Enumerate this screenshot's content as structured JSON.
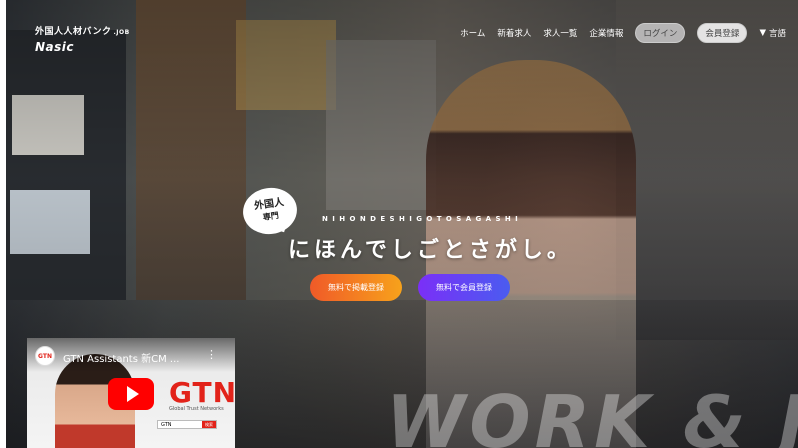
{
  "header": {
    "logo_line1": "外国人人材バンク",
    "logo_suffix": ".JOB",
    "logo_brand": "Nasic"
  },
  "nav": {
    "items": [
      "ホーム",
      "新着求人",
      "求人一覧",
      "企業情報"
    ],
    "login": "ログイン",
    "register": "会員登録",
    "language_arrow": "▼",
    "language": "言語"
  },
  "hero": {
    "badge_line1": "外国人",
    "badge_line2": "専門",
    "romaji": "NIHONDESHIGOTOSAGASHI",
    "headline": "にほんでしごとさがし。",
    "cta_company": "無料で掲載登録",
    "cta_member": "無料で会員登録",
    "watermark": "WORK & JOB"
  },
  "video": {
    "channel_avatar": "GTN",
    "title": "GTN Assistants 新CM ...",
    "brand": "GTN",
    "sub": "Global Trust Networks",
    "search_text": "GTN",
    "search_button": "検索"
  },
  "colors": {
    "cta_company_start": "#f05a28",
    "cta_company_end": "#f7a21b",
    "cta_member_start": "#7b2ff7",
    "cta_member_end": "#4a5cf0",
    "youtube_red": "#ff0000",
    "gtn_red": "#e2231a"
  }
}
